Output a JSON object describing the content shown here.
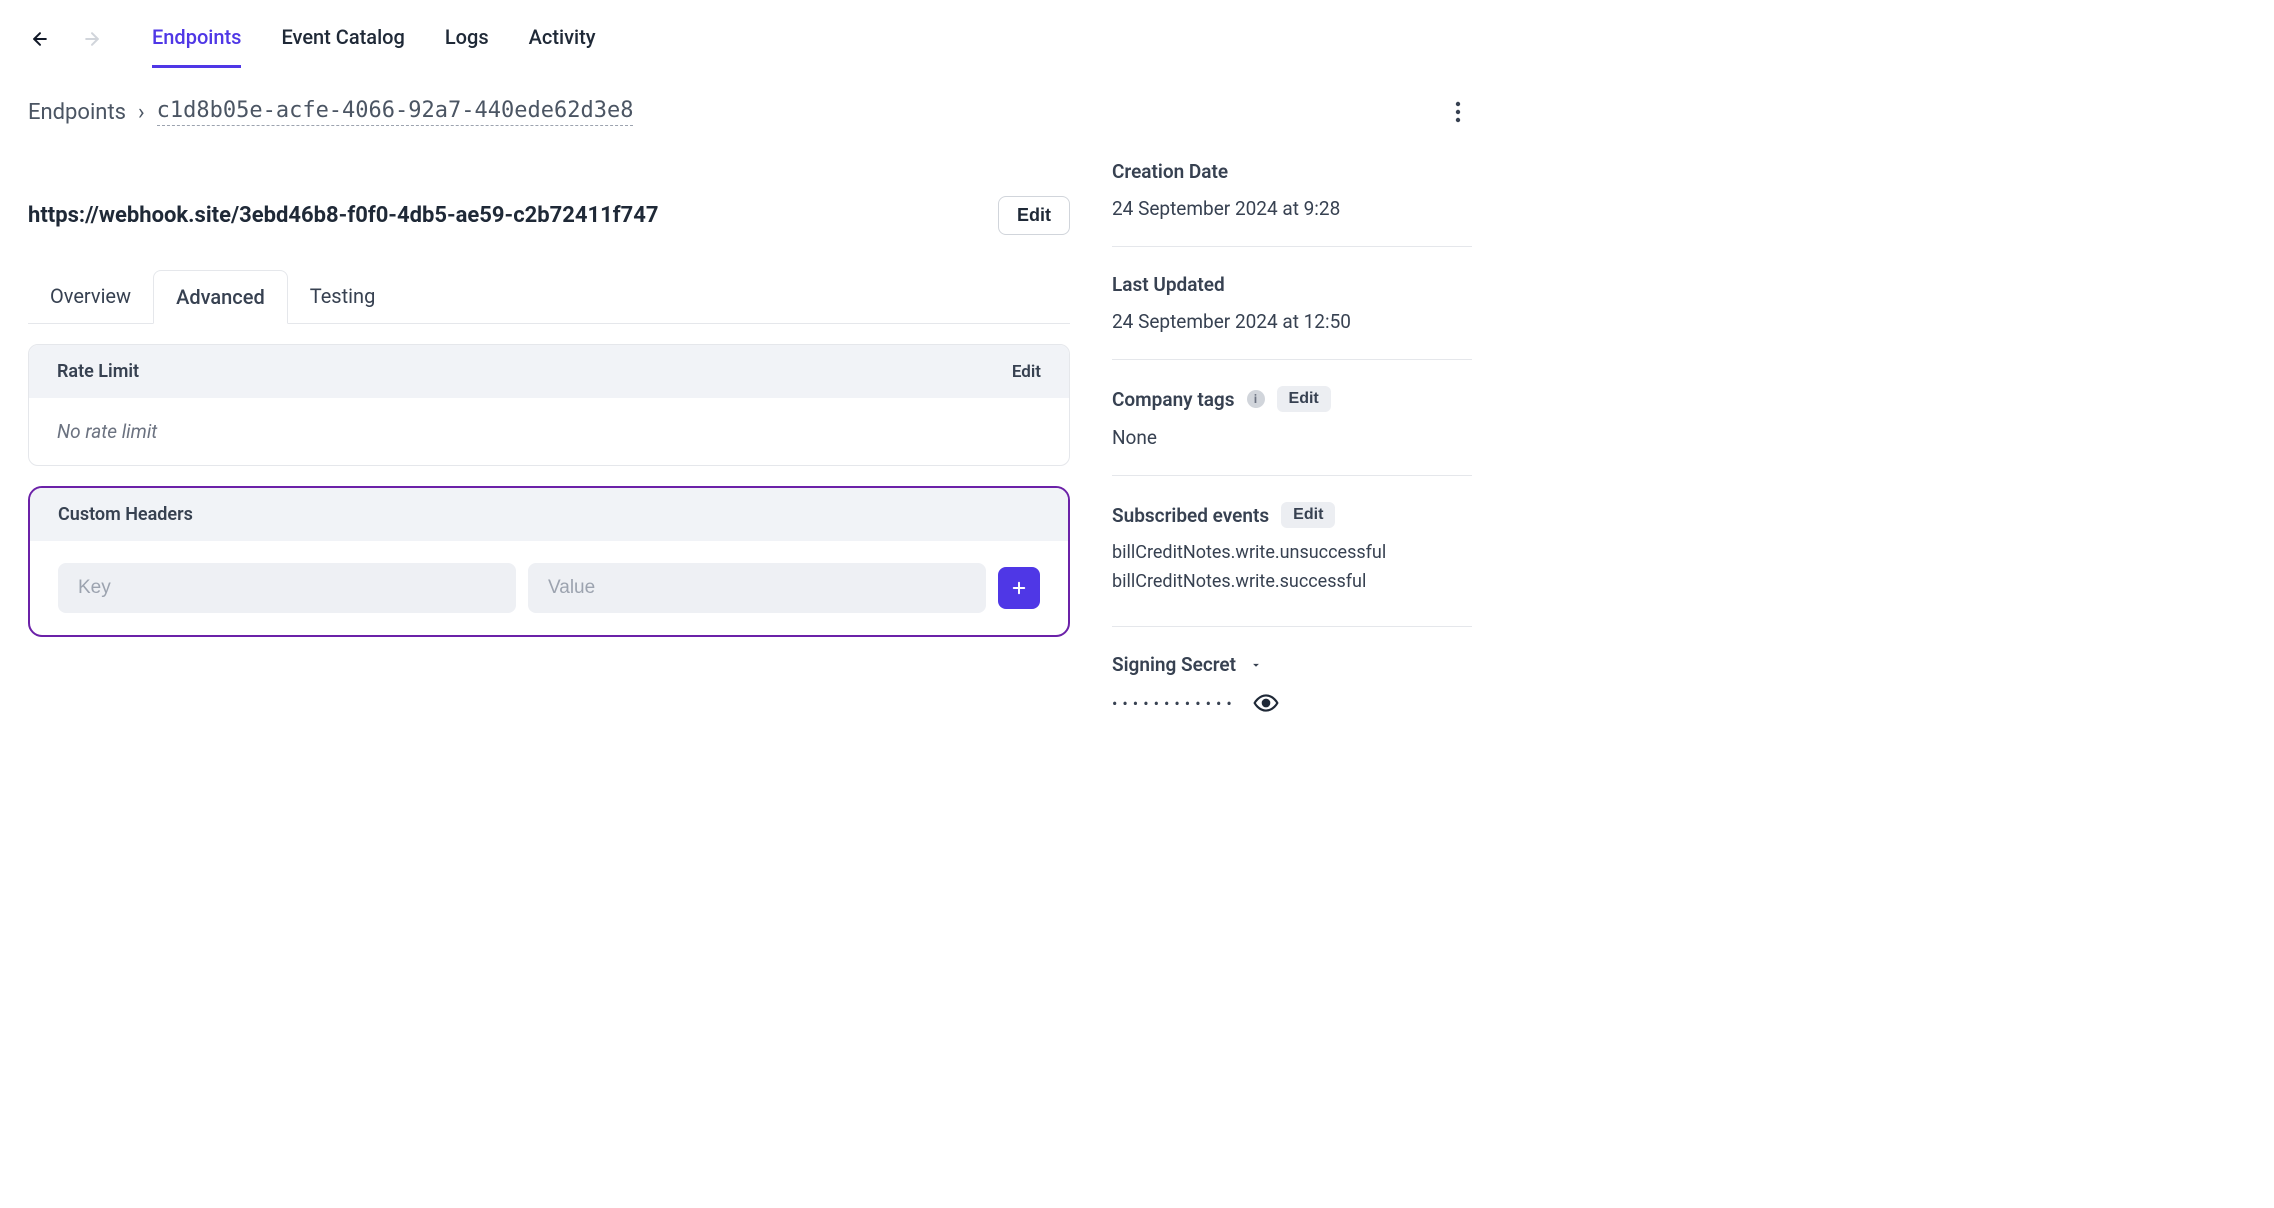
{
  "nav": {
    "tabs": [
      "Endpoints",
      "Event Catalog",
      "Logs",
      "Activity"
    ],
    "active_index": 0
  },
  "breadcrumb": {
    "root": "Endpoints",
    "sep": "›",
    "id": "c1d8b05e-acfe-4066-92a7-440ede62d3e8"
  },
  "endpoint": {
    "url": "https://webhook.site/3ebd46b8-f0f0-4db5-ae59-c2b72411f747",
    "edit_label": "Edit"
  },
  "subtabs": {
    "items": [
      "Overview",
      "Advanced",
      "Testing"
    ],
    "active_index": 1
  },
  "rate_limit": {
    "title": "Rate Limit",
    "edit_label": "Edit",
    "value_text": "No rate limit"
  },
  "custom_headers": {
    "title": "Custom Headers",
    "key_placeholder": "Key",
    "value_placeholder": "Value"
  },
  "side": {
    "creation": {
      "label": "Creation Date",
      "value": "24 September 2024 at 9:28"
    },
    "updated": {
      "label": "Last Updated",
      "value": "24 September 2024 at 12:50"
    },
    "tags": {
      "label": "Company tags",
      "edit_label": "Edit",
      "value": "None"
    },
    "events": {
      "label": "Subscribed events",
      "edit_label": "Edit",
      "items": [
        "billCreditNotes.write.unsuccessful",
        "billCreditNotes.write.successful"
      ]
    },
    "secret": {
      "label": "Signing Secret",
      "masked": "••••••••••••"
    }
  }
}
